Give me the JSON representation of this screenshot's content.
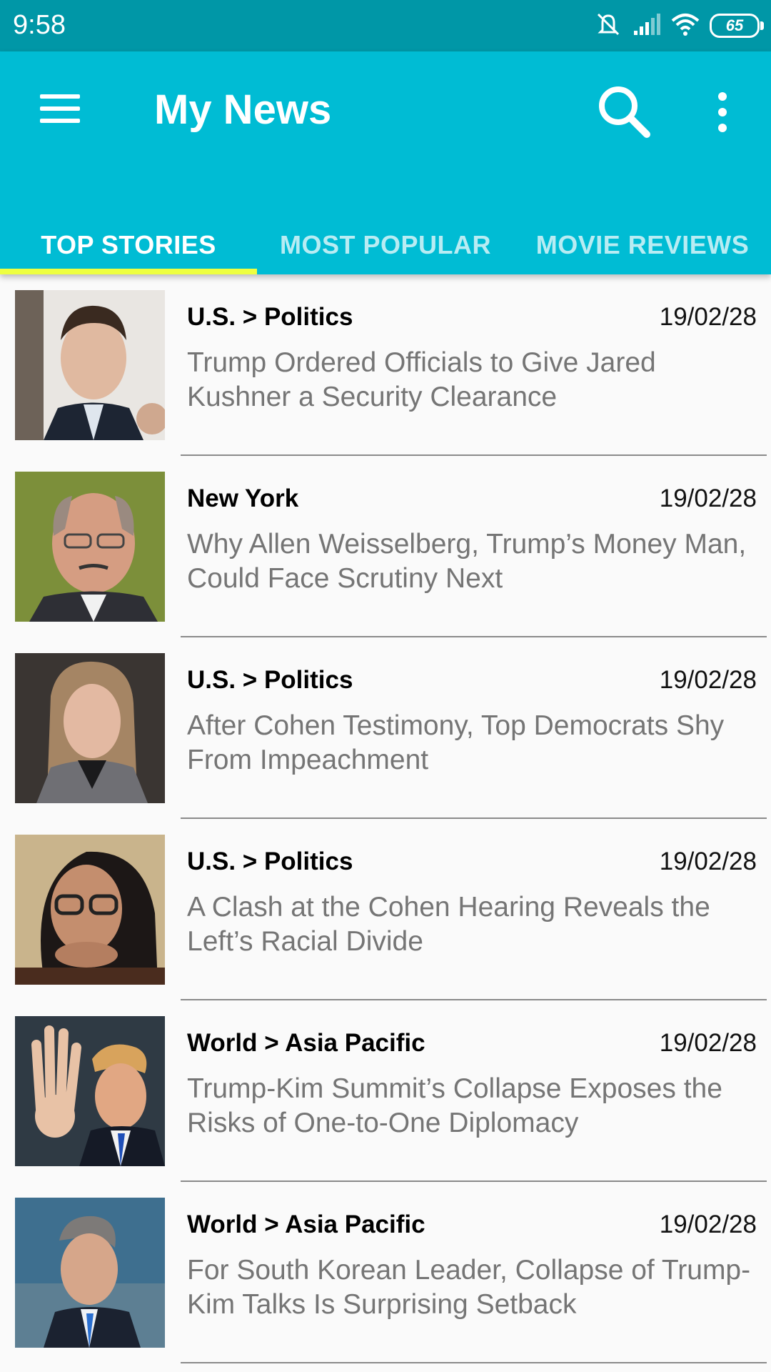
{
  "status_bar": {
    "time": "9:58",
    "battery": "65",
    "icons": [
      "mute-icon",
      "signal-icon",
      "wifi-icon",
      "battery-icon"
    ]
  },
  "app_bar": {
    "title": "My News",
    "background": "#00bcd4",
    "icons": [
      "hamburger-menu-icon",
      "search-icon",
      "more-vert-icon"
    ]
  },
  "tabs": [
    {
      "label": "TOP STORIES",
      "active": true
    },
    {
      "label": "MOST POPULAR",
      "active": false
    },
    {
      "label": "MOVIE REVIEWS",
      "active": false
    }
  ],
  "articles": [
    {
      "section": "U.S. > Politics",
      "date": "19/02/28",
      "headline": "Trump Ordered Officials to Give Jared Kushner a Security Clearance"
    },
    {
      "section": "New York",
      "date": "19/02/28",
      "headline": "Why Allen Weisselberg, Trump’s Money Man, Could Face Scrutiny Next"
    },
    {
      "section": "U.S. > Politics",
      "date": "19/02/28",
      "headline": "After Cohen Testimony, Top Democrats Shy From Impeachment"
    },
    {
      "section": "U.S. > Politics",
      "date": "19/02/28",
      "headline": "A Clash at the Cohen Hearing Reveals the Left’s Racial Divide"
    },
    {
      "section": "World > Asia Pacific",
      "date": "19/02/28",
      "headline": "Trump-Kim Summit’s Collapse Exposes the Risks of One-to-One Diplomacy"
    },
    {
      "section": "World > Asia Pacific",
      "date": "19/02/28",
      "headline": "For South Korean Leader, Collapse of Trump-Kim Talks Is Surprising Setback"
    }
  ]
}
